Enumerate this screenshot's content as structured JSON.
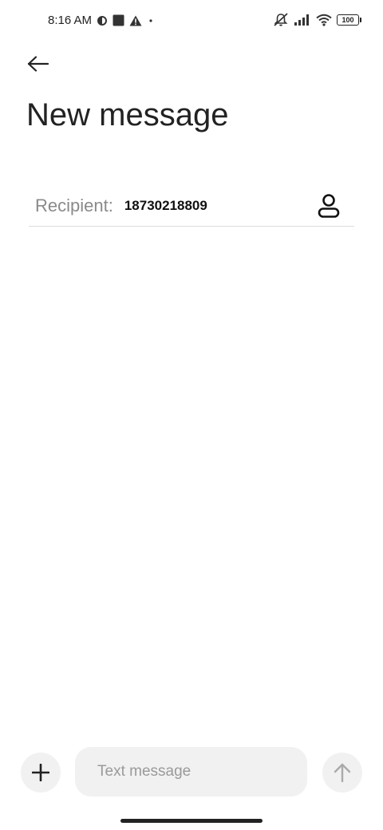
{
  "status_bar": {
    "time": "8:16 AM",
    "battery_level": "100",
    "icons": [
      "circle-half-icon",
      "square-icon",
      "warning-icon",
      "dot-icon",
      "mute-vibrate-icon",
      "signal-icon",
      "wifi-icon",
      "battery-icon"
    ]
  },
  "header": {
    "back_icon": "arrow-left-icon",
    "title": "New message"
  },
  "recipient": {
    "label": "Recipient:",
    "value": "18730218809",
    "contact_icon": "person-icon"
  },
  "compose": {
    "attach_icon": "plus-icon",
    "placeholder": "Text message",
    "value": "",
    "send_icon": "arrow-up-icon"
  },
  "colors": {
    "background": "#ffffff",
    "compose_background": "#f1f1f1",
    "placeholder_text": "#9a9a9a",
    "label_text": "#8a8a8a",
    "divider": "#dcdcdc"
  }
}
